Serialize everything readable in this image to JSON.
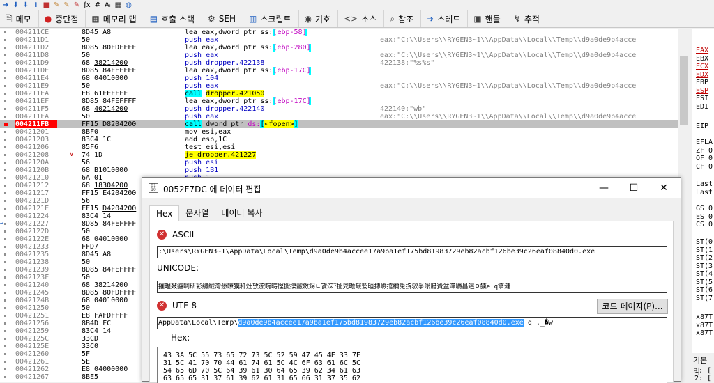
{
  "tabs": [
    {
      "icon": "document-icon",
      "glyph": "🗎",
      "label": "메모"
    },
    {
      "icon": "breakpoint-icon",
      "glyph": "●",
      "label": "중단점"
    },
    {
      "icon": "memory-map-icon",
      "glyph": "▦",
      "label": "메모리 맵"
    },
    {
      "icon": "call-stack-icon",
      "glyph": "▤",
      "label": "호출 스택"
    },
    {
      "icon": "seh-icon",
      "glyph": "⚙",
      "label": "SEH"
    },
    {
      "icon": "script-icon",
      "glyph": "▥",
      "label": "스크립트"
    },
    {
      "icon": "symbols-icon",
      "glyph": "◉",
      "label": "기호"
    },
    {
      "icon": "source-icon",
      "glyph": "<>",
      "label": "소스"
    },
    {
      "icon": "references-icon",
      "glyph": "⌕",
      "label": "참조"
    },
    {
      "icon": "threads-icon",
      "glyph": "➜",
      "label": "스레드"
    },
    {
      "icon": "handles-icon",
      "glyph": "▣",
      "label": "핸들"
    },
    {
      "icon": "trace-icon",
      "glyph": "↯",
      "label": "추적"
    }
  ],
  "disasm_rows": [
    {
      "addr": "004211CE",
      "bytes": "8D45 A8",
      "instr_parts": [
        {
          "t": "lea eax,dword ptr ss:"
        },
        {
          "t": "[ebp-58]",
          "c": "#c000c0",
          "hl": "cyan-b"
        }
      ],
      "cmt": ""
    },
    {
      "addr": "004211D1",
      "bytes": "50",
      "instr_parts": [
        {
          "t": "push eax",
          "c": "#0000c0"
        }
      ],
      "cmt": "eax:\"C:\\\\Users\\\\RYGEN3~1\\\\AppData\\\\Local\\\\Temp\\\\d9a0de9b4acce"
    },
    {
      "addr": "004211D2",
      "bytes": "8D85 80FDFFFF",
      "instr_parts": [
        {
          "t": "lea eax,dword ptr ss:"
        },
        {
          "t": "[ebp-280]",
          "c": "#c000c0",
          "hl": "cyan-b"
        }
      ],
      "cmt": ""
    },
    {
      "addr": "004211D8",
      "bytes": "50",
      "instr_parts": [
        {
          "t": "push eax",
          "c": "#0000c0"
        }
      ],
      "cmt": "eax:\"C:\\\\Users\\\\RYGEN3~1\\\\AppData\\\\Local\\\\Temp\\\\d9a0de9b4acce"
    },
    {
      "addr": "004211D9",
      "bytes": "68 38214200",
      "u": true,
      "instr_parts": [
        {
          "t": "push dropper.422138",
          "c": "#0000c0"
        }
      ],
      "cmt": "422138:\"%s%s\""
    },
    {
      "addr": "004211DE",
      "bytes": "8D85 84FEFFFF",
      "instr_parts": [
        {
          "t": "lea eax,dword ptr ss:"
        },
        {
          "t": "[ebp-17C]",
          "c": "#c000c0",
          "hl": "cyan-b"
        }
      ],
      "cmt": ""
    },
    {
      "addr": "004211E4",
      "bytes": "68 04010000",
      "instr_parts": [
        {
          "t": "push 104",
          "c": "#0000c0"
        }
      ],
      "cmt": ""
    },
    {
      "addr": "004211E9",
      "bytes": "50",
      "instr_parts": [
        {
          "t": "push eax",
          "c": "#0000c0"
        }
      ],
      "cmt": "eax:\"C:\\\\Users\\\\RYGEN3~1\\\\AppData\\\\Local\\\\Temp\\\\d9a0de9b4acce"
    },
    {
      "addr": "004211EA",
      "bytes": "E8 61FEFFFF",
      "instr_parts": [
        {
          "t": "call",
          "hl": "cyan"
        },
        {
          "t": " "
        },
        {
          "t": "dropper.421050",
          "hl": "yellow"
        }
      ],
      "cmt": ""
    },
    {
      "addr": "004211EF",
      "bytes": "8D85 84FEFFFF",
      "instr_parts": [
        {
          "t": "lea eax,dword ptr ss:"
        },
        {
          "t": "[ebp-17C]",
          "c": "#c000c0",
          "hl": "cyan-b"
        }
      ],
      "cmt": ""
    },
    {
      "addr": "004211F5",
      "bytes": "68 40214200",
      "u": true,
      "instr_parts": [
        {
          "t": "push dropper.422140",
          "c": "#0000c0"
        }
      ],
      "cmt": "422140:\"wb\""
    },
    {
      "addr": "004211FA",
      "bytes": "50",
      "instr_parts": [
        {
          "t": "push eax",
          "c": "#0000c0"
        }
      ],
      "cmt": "eax:\"C:\\\\Users\\\\RYGEN3~1\\\\AppData\\\\Local\\\\Temp\\\\d9a0de9b4acce"
    },
    {
      "addr": "004211FB",
      "sel": true,
      "bytes": "FF15 D8204200",
      "u": true,
      "instr_parts": [
        {
          "t": "call",
          "hl": "cyan"
        },
        {
          "t": " dword ptr "
        },
        {
          "t": "ds:",
          "c": "#c000c0"
        },
        {
          "t": "[",
          "hl": "cyan-b"
        },
        {
          "t": "<fopen>",
          "hl": "yellow"
        },
        {
          "t": "]",
          "hl": "cyan-b"
        }
      ],
      "cmt": ""
    },
    {
      "addr": "00421201",
      "bytes": "8BF0",
      "instr_parts": [
        {
          "t": "mov esi,eax"
        }
      ],
      "cmt": ""
    },
    {
      "addr": "00421203",
      "bytes": "83C4 1C",
      "instr_parts": [
        {
          "t": "add esp,1C"
        }
      ],
      "cmt": ""
    },
    {
      "addr": "00421206",
      "bytes": "85F6",
      "instr_parts": [
        {
          "t": "test esi,esi"
        }
      ],
      "cmt": ""
    },
    {
      "addr": "00421208",
      "bytes": "74 1D",
      "jmp": true,
      "instr_parts": [
        {
          "t": "je dropper.421227",
          "hl": "yellow"
        }
      ],
      "cmt": ""
    },
    {
      "addr": "0042120A",
      "bytes": "56",
      "instr_parts": [
        {
          "t": "push esi",
          "c": "#0000c0"
        }
      ],
      "cmt": ""
    },
    {
      "addr": "0042120B",
      "bytes": "68 B1010000",
      "instr_parts": [
        {
          "t": "push 1B1",
          "c": "#0000c0"
        }
      ],
      "cmt": ""
    },
    {
      "addr": "00421210",
      "bytes": "6A 01",
      "instr_parts": [
        {
          "t": "push 1",
          "c": "#0000c0"
        }
      ],
      "cmt": ""
    },
    {
      "addr": "00421212",
      "bytes": "68 18304200",
      "u": true,
      "instr_parts": [],
      "cmt": ""
    },
    {
      "addr": "00421217",
      "bytes": "FF15 E4204200",
      "u": true,
      "instr_parts": [],
      "cmt": ""
    },
    {
      "addr": "0042121D",
      "bytes": "56",
      "instr_parts": [],
      "cmt": ""
    },
    {
      "addr": "0042121E",
      "bytes": "FF15 D4204200",
      "u": true,
      "instr_parts": [],
      "cmt": ""
    },
    {
      "addr": "00421224",
      "bytes": "83C4 14",
      "instr_parts": [],
      "cmt": ""
    },
    {
      "addr": "00421227",
      "bytes": "8D85 84FEFFFF",
      "arrow": true,
      "instr_parts": [],
      "cmt": ""
    },
    {
      "addr": "0042122D",
      "bytes": "50",
      "instr_parts": [],
      "cmt": ""
    },
    {
      "addr": "0042122E",
      "bytes": "68 04010000",
      "instr_parts": [],
      "cmt": ""
    },
    {
      "addr": "00421233",
      "bytes": "FFD7",
      "instr_parts": [],
      "cmt": ""
    },
    {
      "addr": "00421235",
      "bytes": "8D45 A8",
      "instr_parts": [],
      "cmt": ""
    },
    {
      "addr": "00421238",
      "bytes": "50",
      "instr_parts": [],
      "cmt": ""
    },
    {
      "addr": "00421239",
      "bytes": "8D85 84FEFFFF",
      "instr_parts": [],
      "cmt": ""
    },
    {
      "addr": "0042123F",
      "bytes": "50",
      "instr_parts": [],
      "cmt": ""
    },
    {
      "addr": "00421240",
      "bytes": "68 38214200",
      "u": true,
      "instr_parts": [],
      "cmt": ""
    },
    {
      "addr": "00421245",
      "bytes": "8D85 80FDFFFF",
      "instr_parts": [],
      "cmt": ""
    },
    {
      "addr": "0042124B",
      "bytes": "68 04010000",
      "instr_parts": [],
      "cmt": ""
    },
    {
      "addr": "00421250",
      "bytes": "50",
      "instr_parts": [],
      "cmt": ""
    },
    {
      "addr": "00421251",
      "bytes": "E8 FAFDFFFF",
      "instr_parts": [],
      "cmt": ""
    },
    {
      "addr": "00421256",
      "bytes": "8B4D FC",
      "instr_parts": [],
      "cmt": ""
    },
    {
      "addr": "00421259",
      "bytes": "83C4 14",
      "instr_parts": [],
      "cmt": ""
    },
    {
      "addr": "0042125C",
      "bytes": "33CD",
      "instr_parts": [],
      "cmt": ""
    },
    {
      "addr": "0042125E",
      "bytes": "33C0",
      "instr_parts": [],
      "cmt": ""
    },
    {
      "addr": "00421260",
      "bytes": "5F",
      "instr_parts": [],
      "cmt": ""
    },
    {
      "addr": "00421261",
      "bytes": "5E",
      "instr_parts": [],
      "cmt": ""
    },
    {
      "addr": "00421262",
      "bytes": "E8 04000000",
      "instr_parts": [],
      "cmt": ""
    },
    {
      "addr": "00421267",
      "bytes": "8BE5",
      "instr_parts": [],
      "cmt": ""
    }
  ],
  "registers": [
    {
      "name": "EAX",
      "red": true
    },
    {
      "name": "EBX"
    },
    {
      "name": "ECX",
      "red": true
    },
    {
      "name": "EDX",
      "red": true
    },
    {
      "name": "EBP"
    },
    {
      "name": "ESP",
      "red": true
    },
    {
      "name": "ESI"
    },
    {
      "name": "EDI"
    },
    {
      "name": "EIP"
    },
    {
      "name": "EFLA"
    },
    {
      "name": "ZF 0",
      "red": false
    },
    {
      "name": "OF 0"
    },
    {
      "name": "CF 0"
    },
    {
      "name": "Last"
    },
    {
      "name": "Last"
    },
    {
      "name": "GS 0"
    },
    {
      "name": "ES 0"
    },
    {
      "name": "CS 0"
    },
    {
      "name": "ST(0"
    },
    {
      "name": "ST(1"
    },
    {
      "name": "ST(2"
    },
    {
      "name": "ST(3"
    },
    {
      "name": "ST(4"
    },
    {
      "name": "ST(5"
    },
    {
      "name": "ST(6"
    },
    {
      "name": "ST(7"
    },
    {
      "name": "x87T"
    },
    {
      "name": "x87T"
    },
    {
      "name": "x87T"
    }
  ],
  "reg_bottom": {
    "label": "기본리",
    "line1": "1: [",
    "line2": "2: ["
  },
  "dialog": {
    "title": "0052F7DC 에 데이터 편집",
    "minimize": "—",
    "maximize": "☐",
    "close": "✕",
    "tabs": [
      "Hex",
      "문자열",
      "데이터 복사"
    ],
    "ascii_label": "ASCII",
    "ascii_value": ":\\Users\\RYGEN3~1\\AppData\\Local\\Temp\\d9a0de9b4accee17a9ba1ef175bd81983729eb82acbf126be39c26eaf08840d0.exe",
    "unicode_label": "UNICODE:",
    "unicode_value": "摧暒敥獹睭硏彩繡絨灣愻瞭獏䄭灶攷浤睕畴慳擫捿皾敪䤢ㄴ䬥浨⥔扯兕曕敽㼤晅摶嶮捾䌤兎捖欤爭嗡腊篢盆潷皭昌邉ㅇ獯e  q擎漣",
    "utf8_label": "UTF-8",
    "codepage_button": "코드 페이지(P)...",
    "utf8_prefix": "AppData\\Local\\Temp\\",
    "utf8_selected": "d9a0de9b4accee17a9ba1ef175bd81983729eb82acbf126be39c26eaf08840d0.exe",
    "utf8_suffix": "       q ._�w",
    "hex_label": "Hex:",
    "hex_lines": [
      "43 3A 5C 55 73 65 72 73 5C 52 59 47 45 4E 33 7E",
      "31 5C 41 70 70 44 61 74 61 5C 4C 6F 63 61 6C 5C",
      "54 65 6D 70 5C 64 39 61 30 64 65 39 62 34 61 63",
      "63 65 65 31 37 61 39 62 61 31 65 66 31 37 35 62"
    ]
  }
}
